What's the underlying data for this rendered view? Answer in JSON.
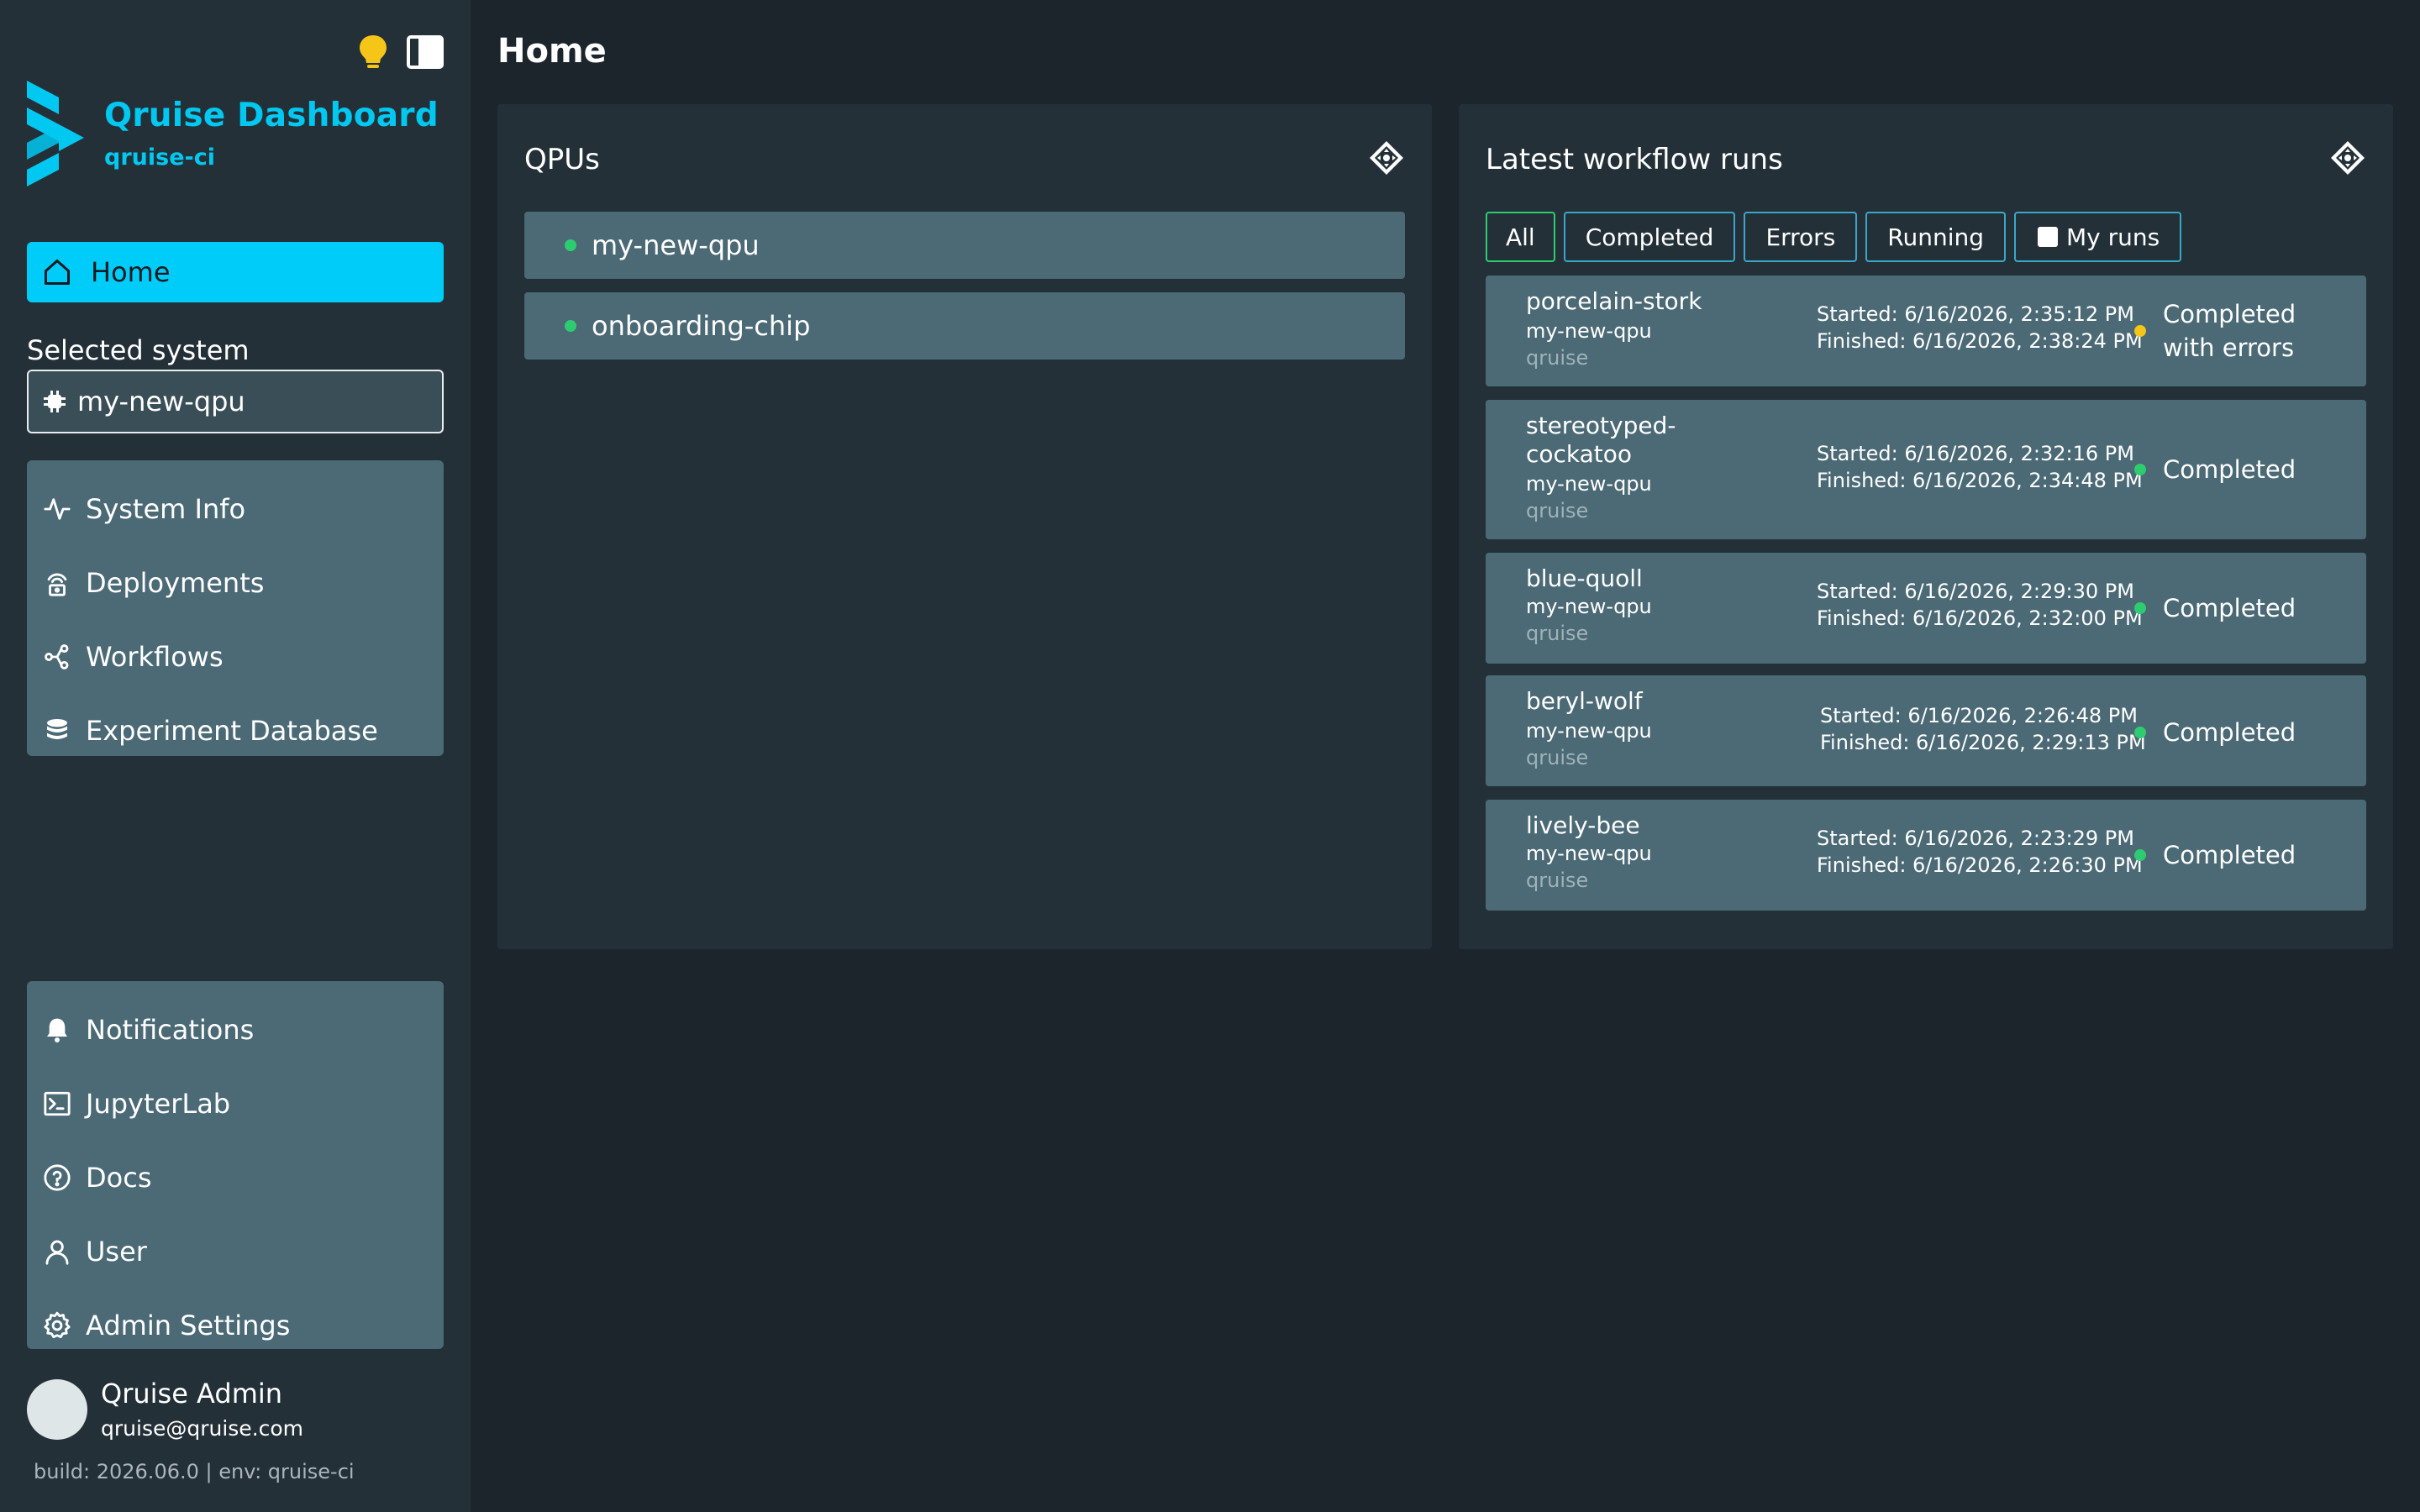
{
  "sidebar": {
    "brand": {
      "title": "Qruise Dashboard",
      "subtitle": "qruise-ci"
    },
    "home_label": "Home",
    "selected_system_label": "Selected system",
    "selected_system_value": "my-new-qpu",
    "group1": [
      {
        "label": "System Info",
        "icon": "activity-icon"
      },
      {
        "label": "Deployments",
        "icon": "broadcast-icon"
      },
      {
        "label": "Workflows",
        "icon": "workflow-icon"
      },
      {
        "label": "Experiment Database",
        "icon": "database-icon"
      }
    ],
    "group2": [
      {
        "label": "Notifications",
        "icon": "bell-icon"
      },
      {
        "label": "JupyterLab",
        "icon": "terminal-icon"
      },
      {
        "label": "Docs",
        "icon": "help-circle-icon"
      },
      {
        "label": "User",
        "icon": "user-icon"
      },
      {
        "label": "Admin Settings",
        "icon": "gear-icon"
      }
    ],
    "user": {
      "name": "Qruise Admin",
      "email": "qruise@qruise.com"
    },
    "build": "build: 2026.06.0 | env: qruise-ci"
  },
  "main": {
    "title": "Home",
    "qpus": {
      "title": "QPUs",
      "items": [
        "my-new-qpu",
        "onboarding-chip"
      ]
    },
    "runs": {
      "title": "Latest workflow runs",
      "filters": [
        "All",
        "Completed",
        "Errors",
        "Running",
        "My runs"
      ],
      "items": [
        {
          "name": "porcelain-stork",
          "qpu": "my-new-qpu",
          "user": "qruise",
          "started": "Started: 6/16/2026, 2:35:12 PM",
          "finished": "Finished: 6/16/2026, 2:38:24 PM",
          "status": "Completed with errors",
          "status_color": "#f5c518"
        },
        {
          "name": "stereotyped-cockatoo",
          "qpu": "my-new-qpu",
          "user": "qruise",
          "started": "Started: 6/16/2026, 2:32:16 PM",
          "finished": "Finished: 6/16/2026, 2:34:48 PM",
          "status": "Completed",
          "status_color": "#2ecc71"
        },
        {
          "name": "blue-quoll",
          "qpu": "my-new-qpu",
          "user": "qruise",
          "started": "Started: 6/16/2026, 2:29:30 PM",
          "finished": "Finished: 6/16/2026, 2:32:00 PM",
          "status": "Completed",
          "status_color": "#2ecc71"
        },
        {
          "name": "beryl-wolf",
          "qpu": "my-new-qpu",
          "user": "qruise",
          "started": "Started: 6/16/2026, 2:26:48 PM",
          "finished": "Finished: 6/16/2026, 2:29:13 PM",
          "status": "Completed",
          "status_color": "#2ecc71"
        },
        {
          "name": "lively-bee",
          "qpu": "my-new-qpu",
          "user": "qruise",
          "started": "Started: 6/16/2026, 2:23:29 PM",
          "finished": "Finished: 6/16/2026, 2:26:30 PM",
          "status": "Completed",
          "status_color": "#2ecc71"
        }
      ]
    }
  },
  "colors": {
    "accent": "#00ccfa",
    "ok": "#2ecc71",
    "warn": "#f5c518"
  }
}
